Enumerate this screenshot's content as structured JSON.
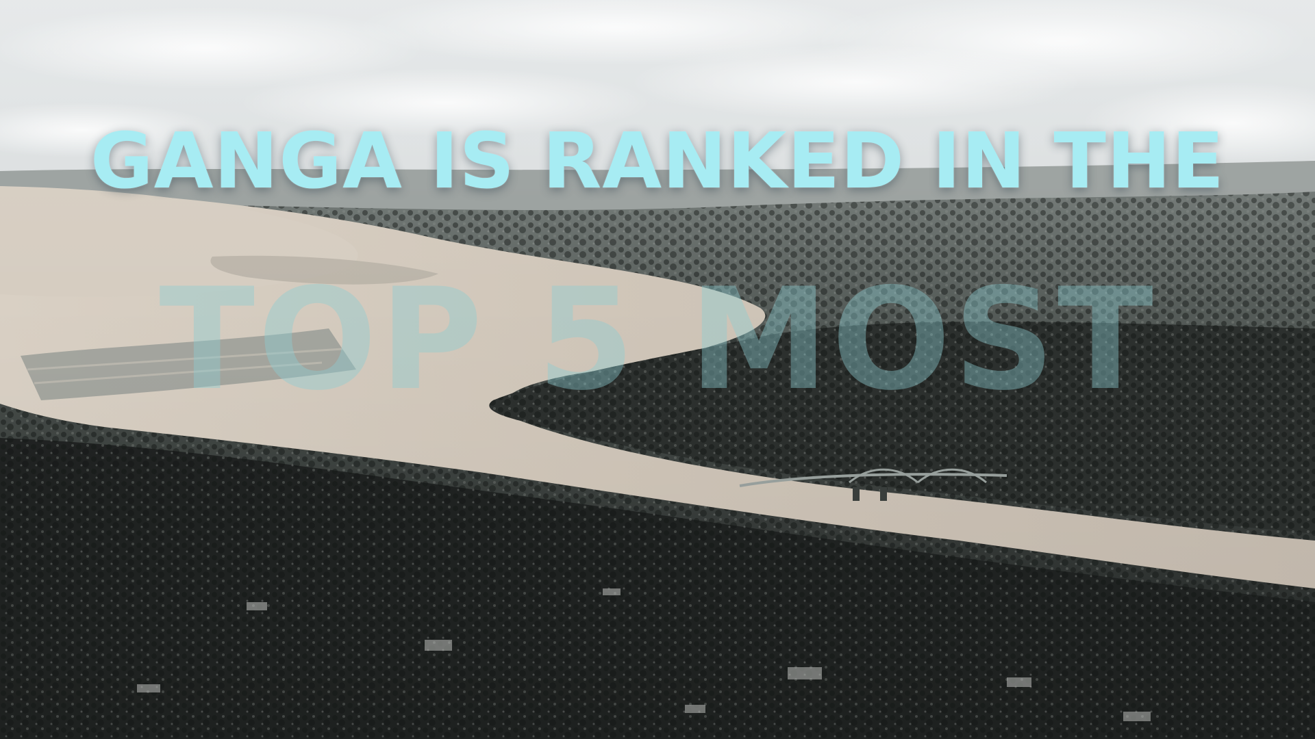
{
  "caption": {
    "line1": "GANGA IS RANKED IN THE",
    "line2": "TOP 5 MOST"
  },
  "colors": {
    "caption_primary": "#a7ecf3",
    "caption_faded": "#8ccdd2",
    "river": "#c9bfb2",
    "land": "#2f3331",
    "sky": "#d8dcdd"
  },
  "scene": {
    "description_icon": "aerial-river-photo"
  }
}
